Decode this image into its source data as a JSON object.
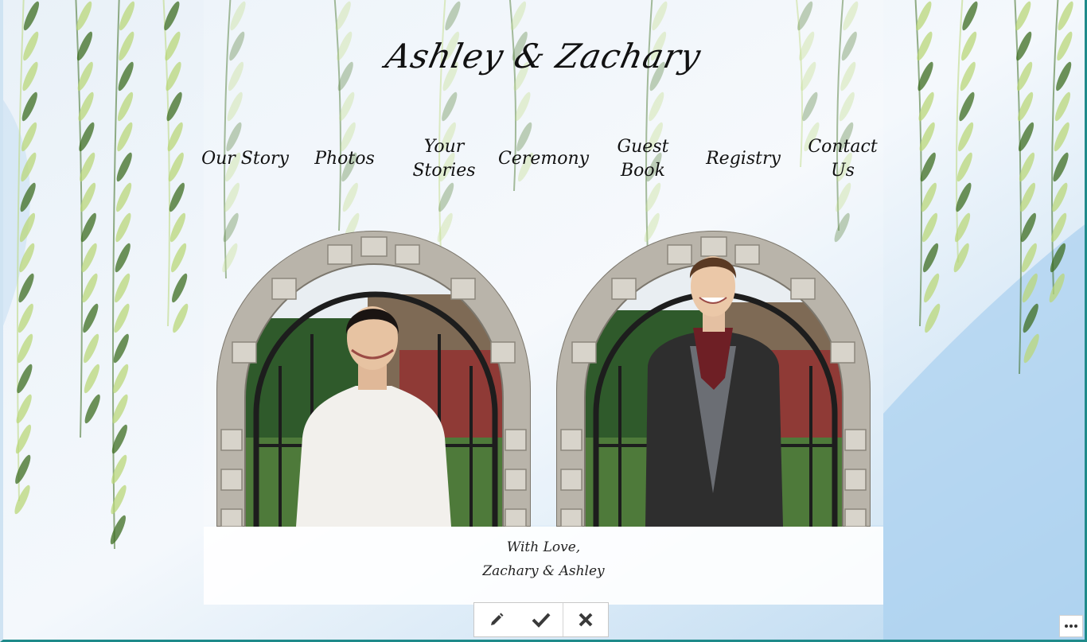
{
  "site": {
    "title": "Ashley & Zachary"
  },
  "nav": {
    "items": [
      {
        "label": "Our Story"
      },
      {
        "label": "Photos"
      },
      {
        "label": "Your\nStories"
      },
      {
        "label": "Ceremony"
      },
      {
        "label": "Guest\nBook"
      },
      {
        "label": "Registry"
      },
      {
        "label": "Contact\nUs"
      }
    ]
  },
  "message": {
    "line1": "With Love,",
    "line2": "Zachary & Ashley"
  },
  "toolbar": {
    "edit_icon": "pencil-icon",
    "confirm_icon": "check-icon",
    "cancel_icon": "close-icon"
  },
  "more_icon": "ellipsis-icon",
  "colors": {
    "sky": "#dde9f4",
    "leaf_light": "#b9d77a",
    "leaf_dark": "#3e6e22",
    "teal_border": "#1e8a8a",
    "brick": "#8f3a36"
  }
}
